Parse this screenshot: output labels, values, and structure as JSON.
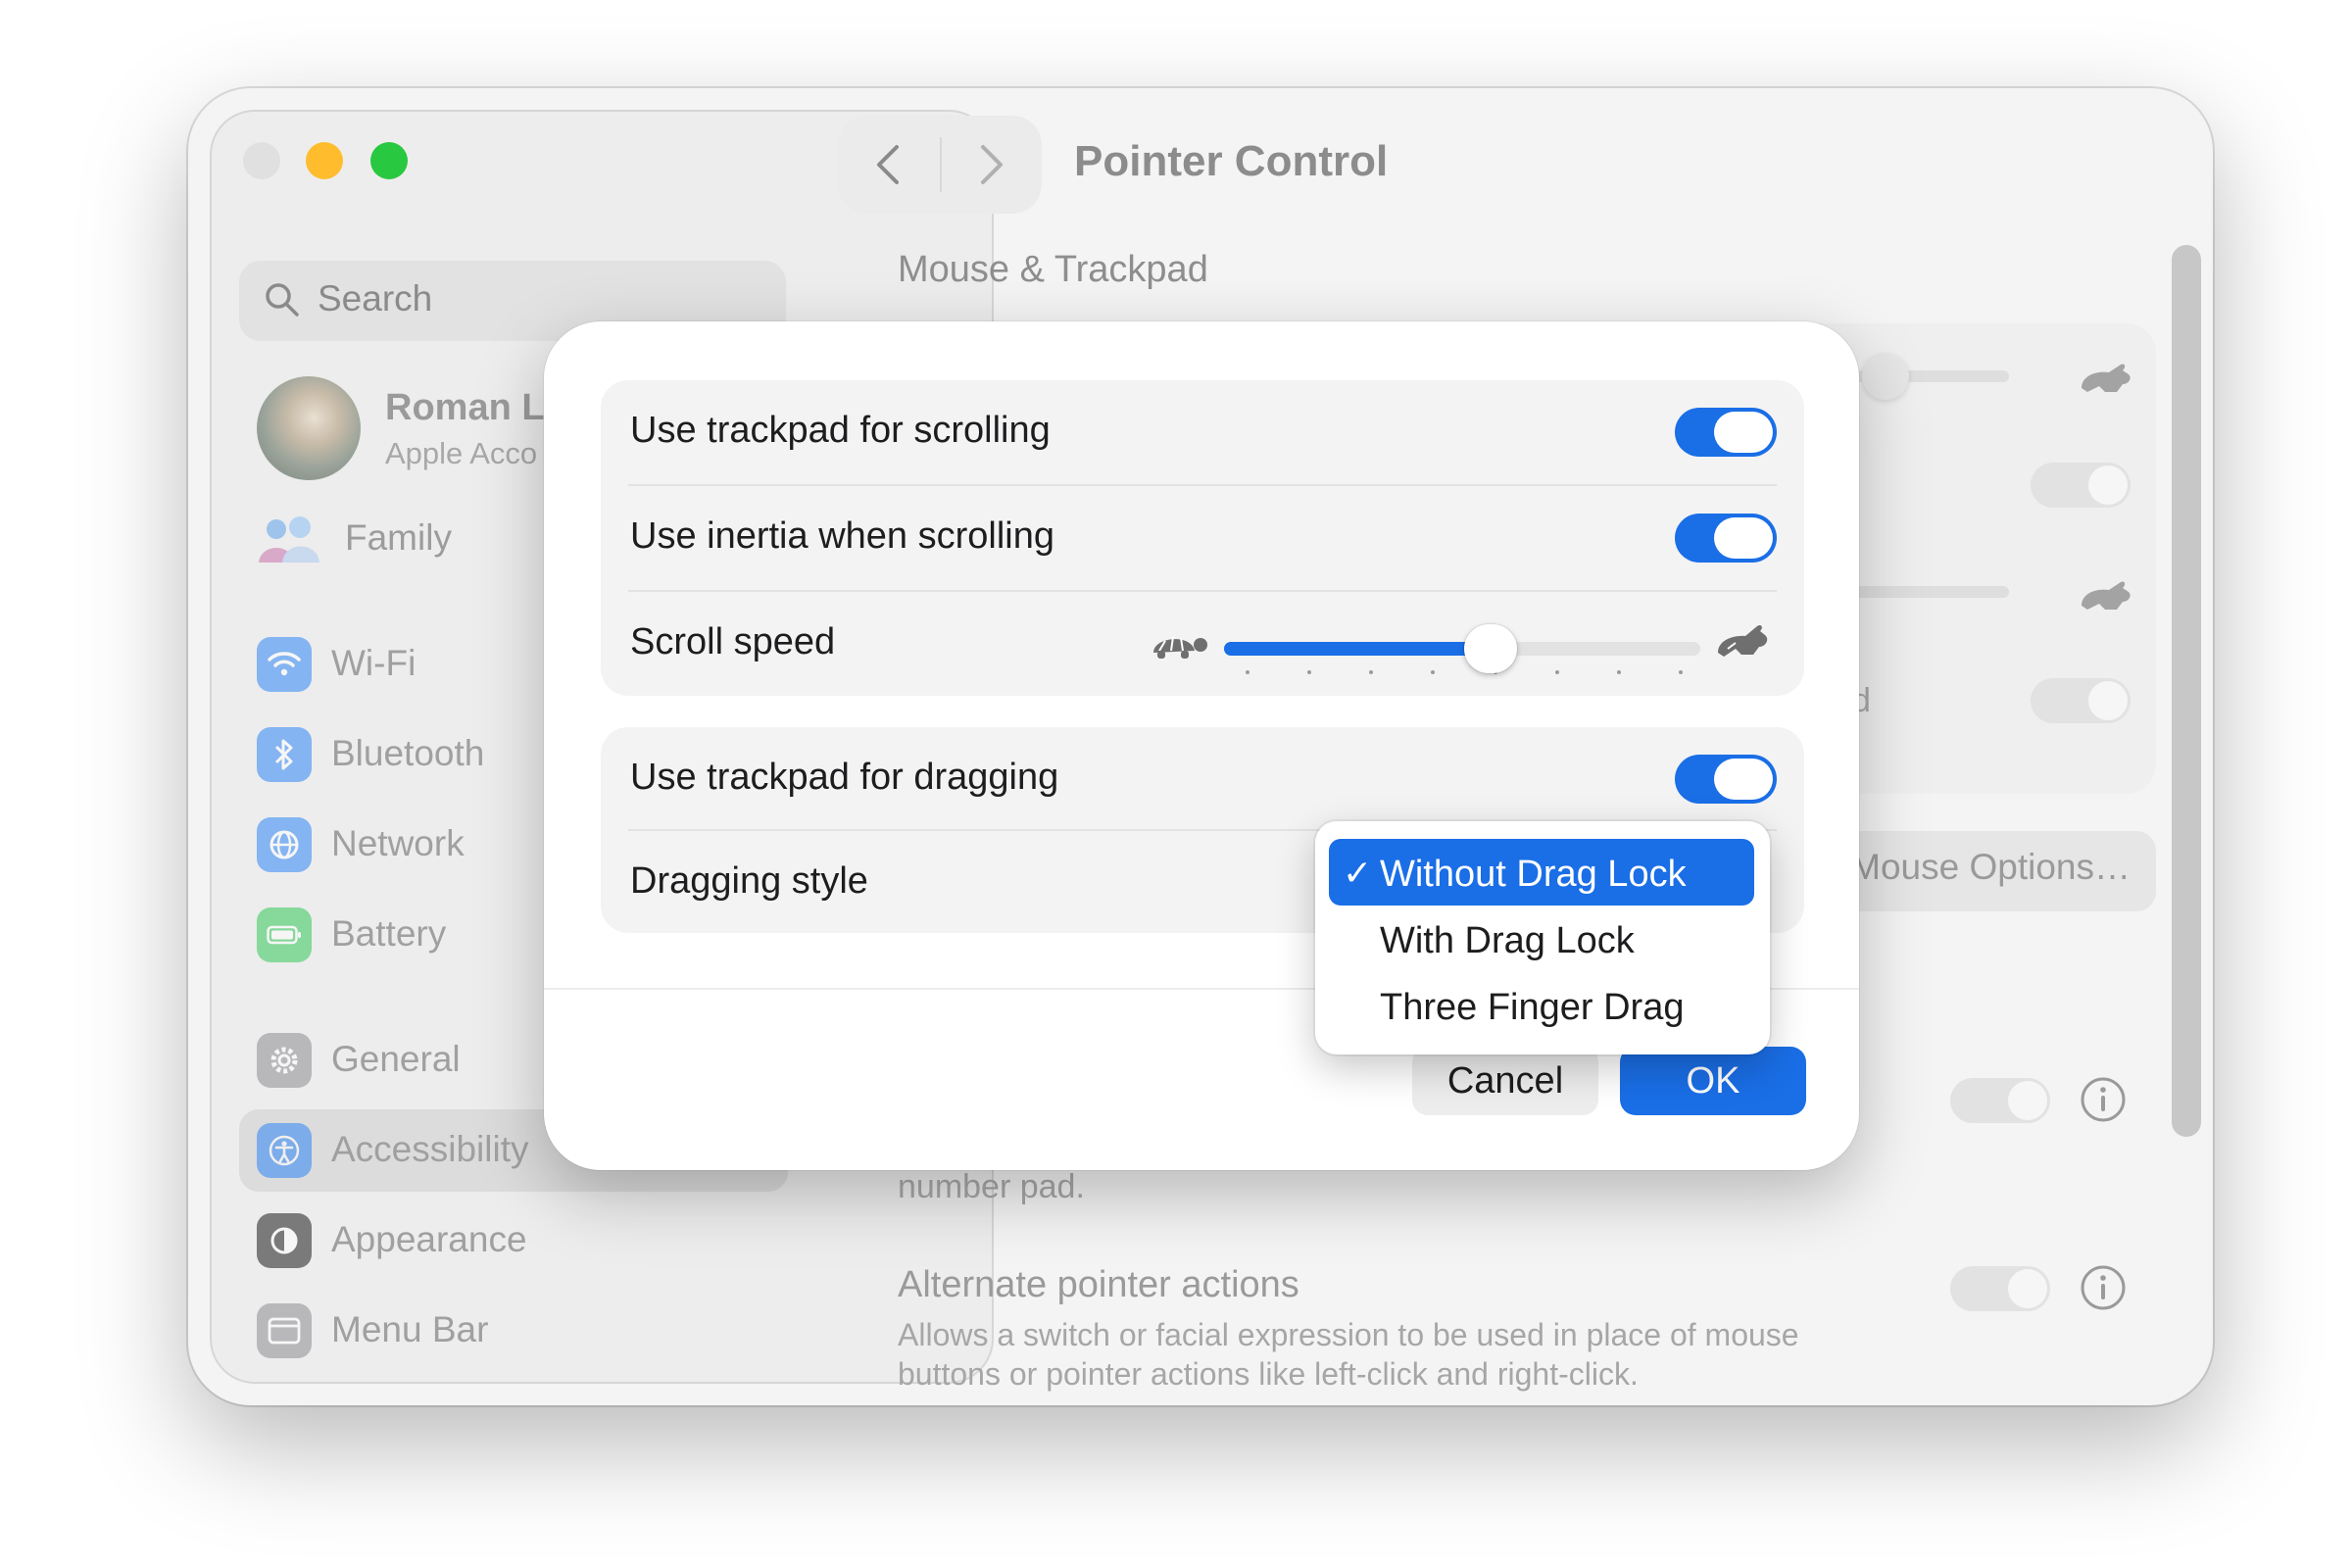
{
  "window": {
    "title": "Pointer Control",
    "section_title": "Mouse & Trackpad"
  },
  "sidebar": {
    "search_placeholder": "Search",
    "user": {
      "name": "Roman L",
      "subtitle": "Apple Acco"
    },
    "family_label": "Family",
    "items": [
      {
        "label": "Wi-Fi",
        "icon": "wifi-icon",
        "color": "#2f86f6"
      },
      {
        "label": "Bluetooth",
        "icon": "bluetooth-icon",
        "color": "#2f86f6"
      },
      {
        "label": "Network",
        "icon": "globe-icon",
        "color": "#2f86f6"
      },
      {
        "label": "Battery",
        "icon": "battery-icon",
        "color": "#34c759"
      },
      {
        "label": "General",
        "icon": "gear-icon",
        "color": "#8e8e93"
      },
      {
        "label": "Accessibility",
        "icon": "accessibility-icon",
        "color": "#2f86f6"
      },
      {
        "label": "Appearance",
        "icon": "appearance-icon",
        "color": "#1d1d1f"
      },
      {
        "label": "Menu Bar",
        "icon": "menubar-icon",
        "color": "#8e8e93"
      }
    ],
    "selected_item": "Accessibility"
  },
  "background": {
    "options_button": "Mouse Options…",
    "fragment_char": "d",
    "number_pad_text": "number pad.",
    "alternate_title": "Alternate pointer actions",
    "alternate_desc": "Allows a switch or facial expression to be used in place of mouse buttons or pointer actions like left-click and right-click."
  },
  "sheet": {
    "scrolling": {
      "use_trackpad_label": "Use trackpad for scrolling",
      "use_trackpad_on": true,
      "inertia_label": "Use inertia when scrolling",
      "inertia_on": true,
      "speed_label": "Scroll speed",
      "speed_value": 0.56,
      "speed_ticks": 8
    },
    "dragging": {
      "use_trackpad_label": "Use trackpad for dragging",
      "use_trackpad_on": true,
      "style_label": "Dragging style"
    },
    "cancel_label": "Cancel",
    "ok_label": "OK"
  },
  "menu": {
    "check": "✓",
    "options": [
      "Without Drag Lock",
      "With Drag Lock",
      "Three Finger Drag"
    ],
    "selected": 0
  },
  "colors": {
    "accent": "#1a6ee6",
    "close": "#e0e0e0",
    "minimize": "#ffbd2e",
    "maximize": "#28c840"
  }
}
